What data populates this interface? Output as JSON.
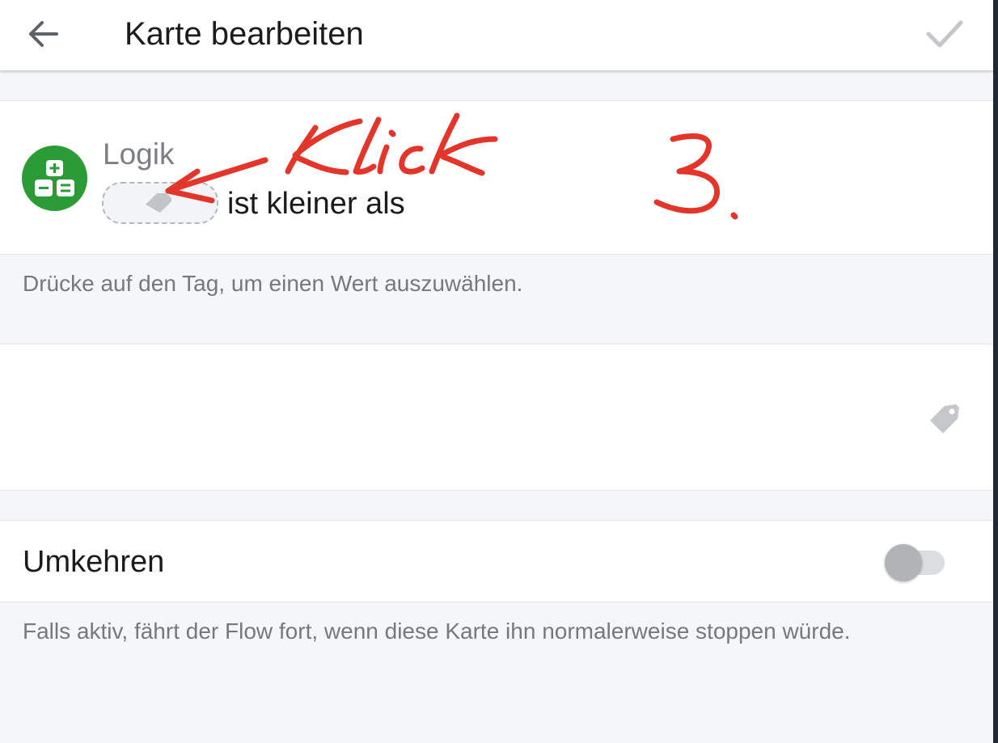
{
  "appbar": {
    "title": "Karte bearbeiten",
    "back_icon": "arrow-left-icon",
    "confirm_icon": "check-icon"
  },
  "card": {
    "owner": "Logik",
    "text": "ist kleiner als",
    "app_icon": "logic-calculator-icon",
    "tag_icon": "tag-icon",
    "app_color": "#2a9b35"
  },
  "hints": {
    "tag_hint": "Drücke auf den Tag, um einen Wert auszuwählen.",
    "invert_hint": "Falls aktiv, fährt der Flow fort, wenn diese Karte ihn normalerweise stoppen würde."
  },
  "value_field": {
    "value": "",
    "icon": "tag-icon"
  },
  "invert": {
    "label": "Umkehren",
    "enabled": false
  },
  "annotation": {
    "handwritten_word": "Klick",
    "handwritten_number": "3.",
    "color": "#e4352b"
  }
}
